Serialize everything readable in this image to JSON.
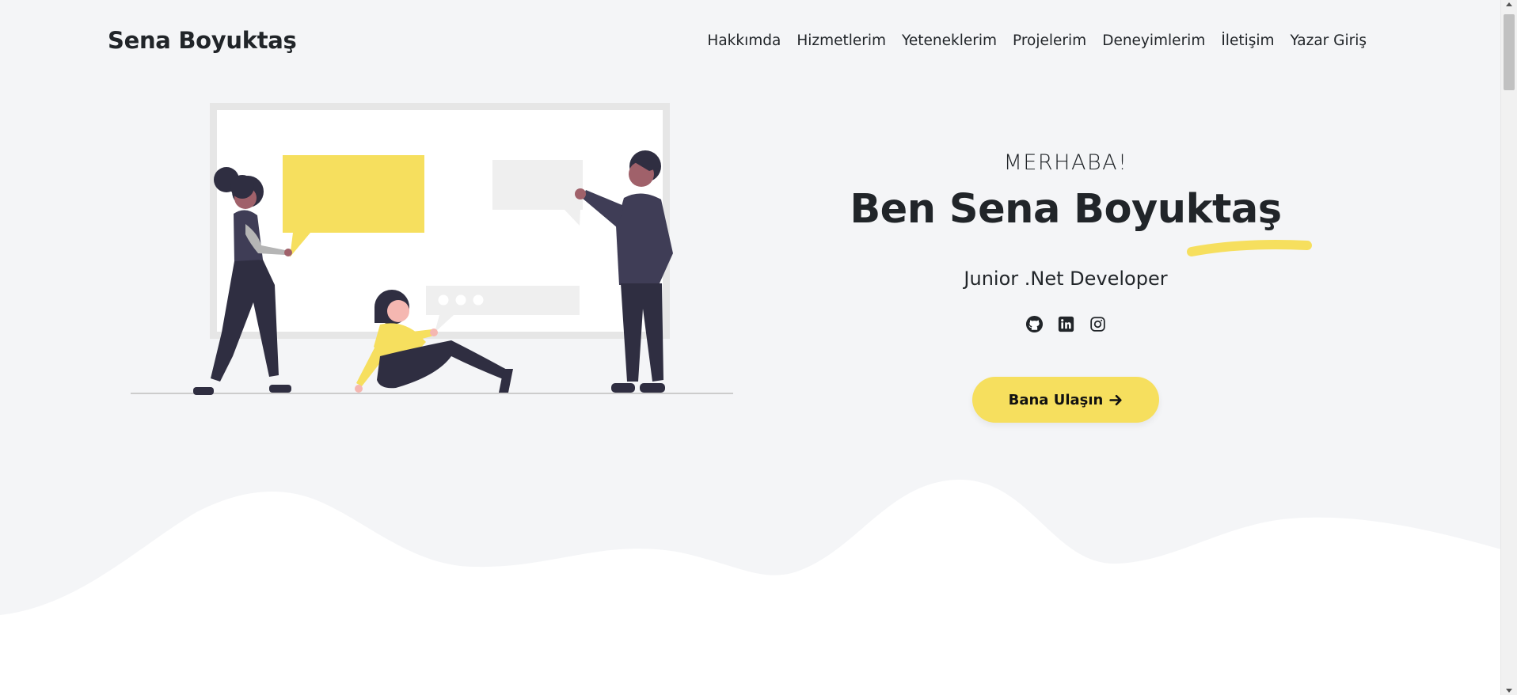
{
  "brand": {
    "name": "Sena Boyuktaş"
  },
  "nav": {
    "items": [
      {
        "label": "Hakkımda"
      },
      {
        "label": "Hizmetlerim"
      },
      {
        "label": "Yeteneklerim"
      },
      {
        "label": "Projelerim"
      },
      {
        "label": "Deneyimlerim"
      },
      {
        "label": "İletişim"
      },
      {
        "label": "Yazar Giriş"
      }
    ]
  },
  "hero": {
    "greeting": "MERHABA!",
    "headline": "Ben Sena Boyuktaş",
    "subtitle": "Junior .Net Developer",
    "socials": [
      {
        "icon": "github-icon"
      },
      {
        "icon": "linkedin-icon"
      },
      {
        "icon": "instagram-icon"
      }
    ],
    "cta_label": "Bana Ulaşın",
    "cta_icon": "arrow-right-icon"
  },
  "colors": {
    "background": "#f4f5f7",
    "accent_yellow": "#f6df5e",
    "text": "#212529",
    "figure_dark": "#2f2e41",
    "wave": "#ffffff"
  }
}
